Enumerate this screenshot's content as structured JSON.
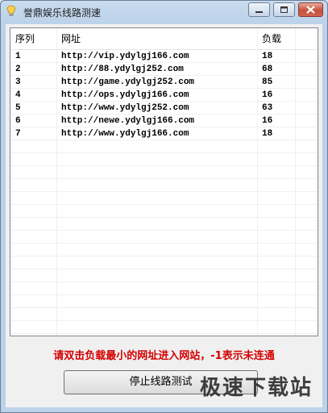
{
  "window": {
    "title": "誉鼎娱乐线路测速",
    "icons": {
      "app": "lightbulb-icon",
      "minimize": "minimize-icon",
      "maximize": "maximize-icon",
      "close": "close-icon"
    }
  },
  "table": {
    "columns": [
      "序列",
      "网址",
      "负载"
    ],
    "rows": [
      [
        "1",
        "http://vip.ydylgj166.com",
        "18"
      ],
      [
        "2",
        "http://88.ydylgj252.com",
        "68"
      ],
      [
        "3",
        "http://game.ydylgj252.com",
        "85"
      ],
      [
        "4",
        "http://ops.ydylgj166.com",
        "16"
      ],
      [
        "5",
        "http://www.ydylgj252.com",
        "63"
      ],
      [
        "6",
        "http://newe.ydylgj166.com",
        "16"
      ],
      [
        "7",
        "http://www.ydylgj166.com",
        "18"
      ]
    ]
  },
  "notice": "请双击负载最小的网址进入网站，-1表示未连通",
  "stop_button": "停止线路测试",
  "watermark": "极速下载站",
  "colors": {
    "notice": "#d40000",
    "titlebar": "#c9dbee"
  }
}
